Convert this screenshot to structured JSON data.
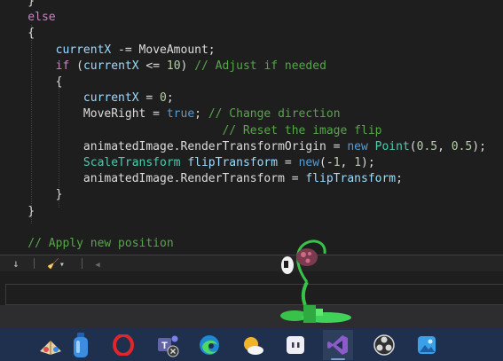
{
  "code": {
    "lines": [
      [
        {
          "c": "plain",
          "t": "    }"
        }
      ],
      [
        {
          "c": "kw",
          "t": "    else"
        }
      ],
      [
        {
          "c": "plain",
          "t": "    {"
        }
      ],
      [
        {
          "c": "var",
          "t": "        currentX"
        },
        {
          "c": "plain",
          "t": " -= MoveAmount;"
        }
      ],
      [
        {
          "c": "kw",
          "t": "        if"
        },
        {
          "c": "plain",
          "t": " ("
        },
        {
          "c": "var",
          "t": "currentX"
        },
        {
          "c": "plain",
          "t": " <= "
        },
        {
          "c": "num",
          "t": "10"
        },
        {
          "c": "plain",
          "t": ") "
        },
        {
          "c": "cmt",
          "t": "// Adjust if needed"
        }
      ],
      [
        {
          "c": "plain",
          "t": "        {"
        }
      ],
      [
        {
          "c": "var",
          "t": "            currentX"
        },
        {
          "c": "plain",
          "t": " = "
        },
        {
          "c": "num",
          "t": "0"
        },
        {
          "c": "plain",
          "t": ";"
        }
      ],
      [
        {
          "c": "plain",
          "t": "            MoveRight = "
        },
        {
          "c": "blue",
          "t": "true"
        },
        {
          "c": "plain",
          "t": "; "
        },
        {
          "c": "cmt",
          "t": "// Change direction"
        }
      ],
      [
        {
          "c": "cmt",
          "t": "                                // Reset the image flip"
        }
      ],
      [
        {
          "c": "plain",
          "t": "            animatedImage.RenderTransformOrigin = "
        },
        {
          "c": "blue",
          "t": "new"
        },
        {
          "c": "plain",
          "t": " "
        },
        {
          "c": "type",
          "t": "Point"
        },
        {
          "c": "plain",
          "t": "("
        },
        {
          "c": "num",
          "t": "0.5"
        },
        {
          "c": "plain",
          "t": ", "
        },
        {
          "c": "num",
          "t": "0.5"
        },
        {
          "c": "plain",
          "t": ");"
        }
      ],
      [
        {
          "c": "type",
          "t": "            ScaleTransform"
        },
        {
          "c": "plain",
          "t": " "
        },
        {
          "c": "var",
          "t": "flipTransform"
        },
        {
          "c": "plain",
          "t": " = "
        },
        {
          "c": "blue",
          "t": "new"
        },
        {
          "c": "plain",
          "t": "(-"
        },
        {
          "c": "num",
          "t": "1"
        },
        {
          "c": "plain",
          "t": ", "
        },
        {
          "c": "num",
          "t": "1"
        },
        {
          "c": "plain",
          "t": ");"
        }
      ],
      [
        {
          "c": "plain",
          "t": "            animatedImage.RenderTransform = "
        },
        {
          "c": "var",
          "t": "flipTransform"
        },
        {
          "c": "plain",
          "t": ";"
        }
      ],
      [
        {
          "c": "plain",
          "t": "        }"
        }
      ],
      [
        {
          "c": "plain",
          "t": "    }"
        }
      ],
      [
        {
          "c": "plain",
          "t": ""
        }
      ],
      [
        {
          "c": "cmt",
          "t": "    // Apply new position"
        }
      ]
    ]
  },
  "toolbar": {
    "down_arrow": "↓",
    "brush": "🧹",
    "dropdown": "▾",
    "scroll_left": "◀"
  },
  "taskbar": {
    "items": [
      {
        "name": "paint-app-icon",
        "color": "#c8a060"
      },
      {
        "name": "bottle-app-icon",
        "color": "#3a8de0"
      },
      {
        "name": "opera-icon",
        "color": "#e0252d"
      },
      {
        "name": "teams-icon",
        "color": "#6264a7"
      },
      {
        "name": "edge-icon",
        "color": "#2a9ad8"
      },
      {
        "name": "weather-icon",
        "color": "#f0b429"
      },
      {
        "name": "chat-app-icon",
        "color": "#e8e8f0"
      },
      {
        "name": "visual-studio-icon",
        "color": "#8b5cc9"
      },
      {
        "name": "obs-icon",
        "color": "#d8d8d8"
      },
      {
        "name": "photos-icon",
        "color": "#3aa0e8"
      }
    ]
  }
}
